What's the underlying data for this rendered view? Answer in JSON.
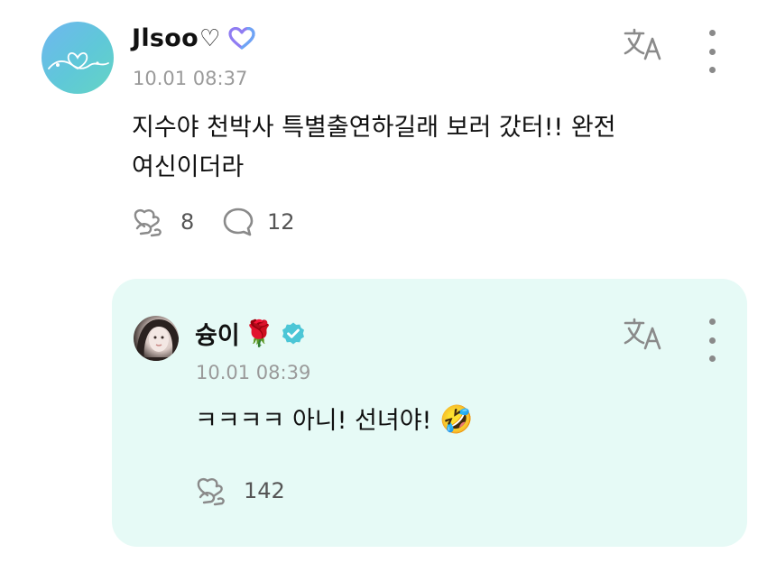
{
  "post": {
    "author": {
      "name": "Jlsoo",
      "name_suffix": "♡",
      "badge_icon": "artist-heart-badge-icon",
      "avatar_icon": "heart-doodle-avatar"
    },
    "timestamp": "10.01 08:37",
    "body_line1": "지수야 천박사 특별출연하길래 보러 갔터!! 완전",
    "body_line2": "여신이더라",
    "like_count": "8",
    "comment_count": "12",
    "translate_icon": "translate-icon",
    "more_icon": "more-vertical-icon"
  },
  "reply": {
    "author": {
      "name": "슝이",
      "name_emoji": "🌹",
      "verified_icon": "verified-check-icon"
    },
    "timestamp": "10.01 08:39",
    "body_text": "ㅋㅋㅋㅋ 아니! 선녀야! ",
    "body_emoji": "🤣",
    "like_count": "142",
    "translate_icon": "translate-icon",
    "more_icon": "more-vertical-icon"
  },
  "colors": {
    "reply_background": "#e6faf6",
    "badge_purple": "#8f7cf2",
    "badge_blue": "#6ea4f5",
    "verified_teal": "#4cc6d6",
    "muted_text": "#9a9a9a"
  }
}
